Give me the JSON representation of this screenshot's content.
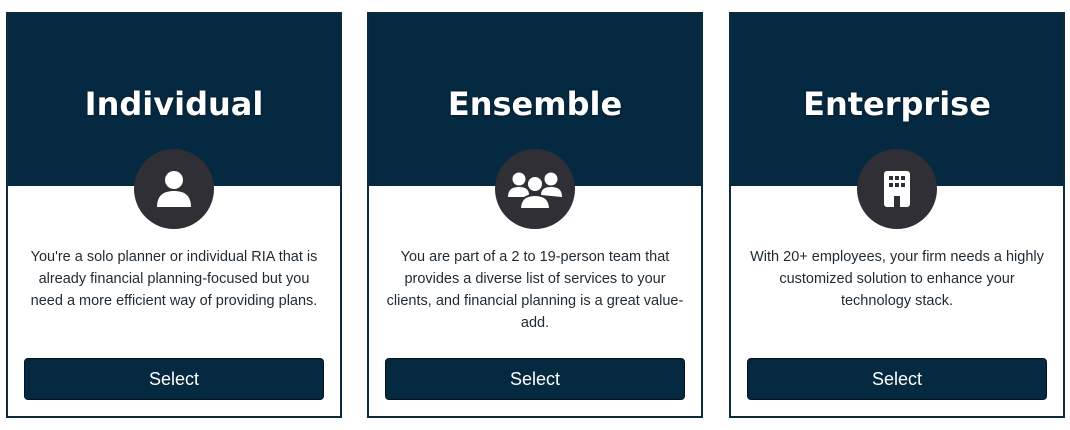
{
  "colors": {
    "header_bg": "#052940",
    "icon_circle_bg": "#2f2f35",
    "button_bg": "#052940",
    "text": "#1f2a33"
  },
  "cards": [
    {
      "title": "Individual",
      "icon": "person-icon",
      "description": "You're a solo planner or individual RIA that is already financial planning-focused but you need a more efficient way of providing plans.",
      "button_label": "Select"
    },
    {
      "title": "Ensemble",
      "icon": "group-icon",
      "description": "You are part of a 2 to 19-person team that provides a diverse list of services to your clients, and financial planning is a great value-add.",
      "button_label": "Select"
    },
    {
      "title": "Enterprise",
      "icon": "building-icon",
      "description": "With 20+ employees, your firm needs a highly customized solution to enhance your technology stack.",
      "button_label": "Select"
    }
  ]
}
